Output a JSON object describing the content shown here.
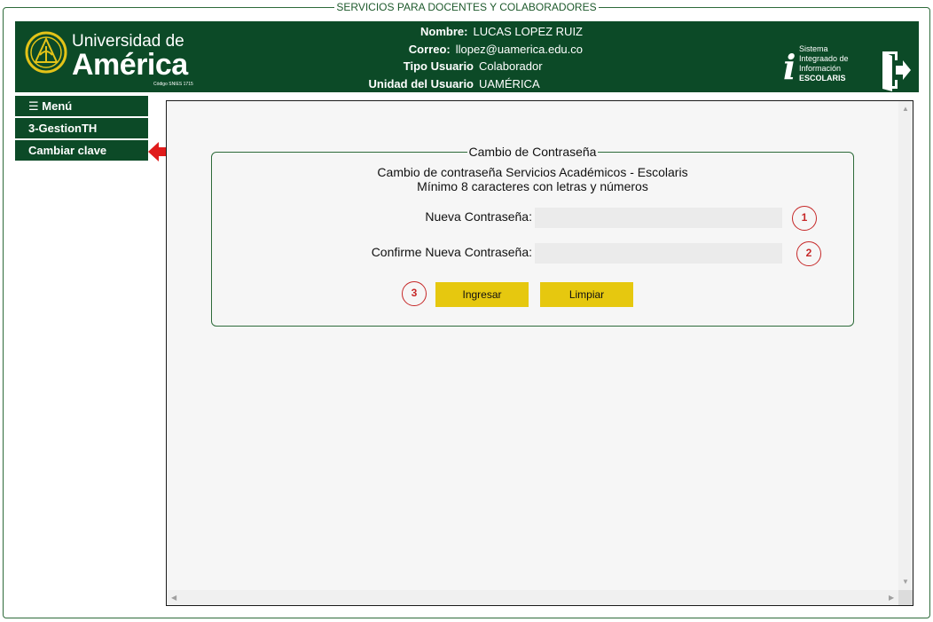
{
  "page": {
    "frame_title": "SERVICIOS PARA DOCENTES Y COLABORADORES"
  },
  "header": {
    "logo": {
      "line1": "Universidad de",
      "line2": "América",
      "line3": "Código SNIES 1715"
    },
    "user": {
      "nombre_label": "Nombre:",
      "nombre_value": "LUCAS LOPEZ RUIZ",
      "correo_label": "Correo:",
      "correo_value": "llopez@uamerica.edu.co",
      "tipo_label": "Tipo Usuario",
      "tipo_value": "Colaborador",
      "unidad_label": "Unidad del Usuario",
      "unidad_value": "UAMÉRICA"
    },
    "system_badge": {
      "letter": "i",
      "line1": "Sistema",
      "line2": "Integraado de",
      "line3": "Información",
      "line4": "ESCOLARIS"
    },
    "logout_icon": "exit-door-icon"
  },
  "sidebar": {
    "items": [
      {
        "label": "☰ Menú"
      },
      {
        "label": "3-GestionTH"
      },
      {
        "label": "Cambiar clave"
      }
    ],
    "pointer_icon": "red-left-arrow-icon"
  },
  "form": {
    "legend": "Cambio de Contraseña",
    "description_line1": "Cambio de contraseña Servicios Académicos - Escolaris",
    "description_line2": "Mínimo 8 caracteres con letras y números",
    "new_password_label": "Nueva Contraseña:",
    "new_password_value": "",
    "confirm_password_label": "Confirme Nueva Contraseña:",
    "confirm_password_value": "",
    "callouts": [
      "1",
      "2",
      "3"
    ],
    "submit_label": "Ingresar",
    "clear_label": "Limpiar"
  },
  "colors": {
    "brand_green": "#0c4a27",
    "button_yellow": "#e6c80f",
    "callout_red": "#c62828",
    "logo_gold": "#e3c318"
  }
}
